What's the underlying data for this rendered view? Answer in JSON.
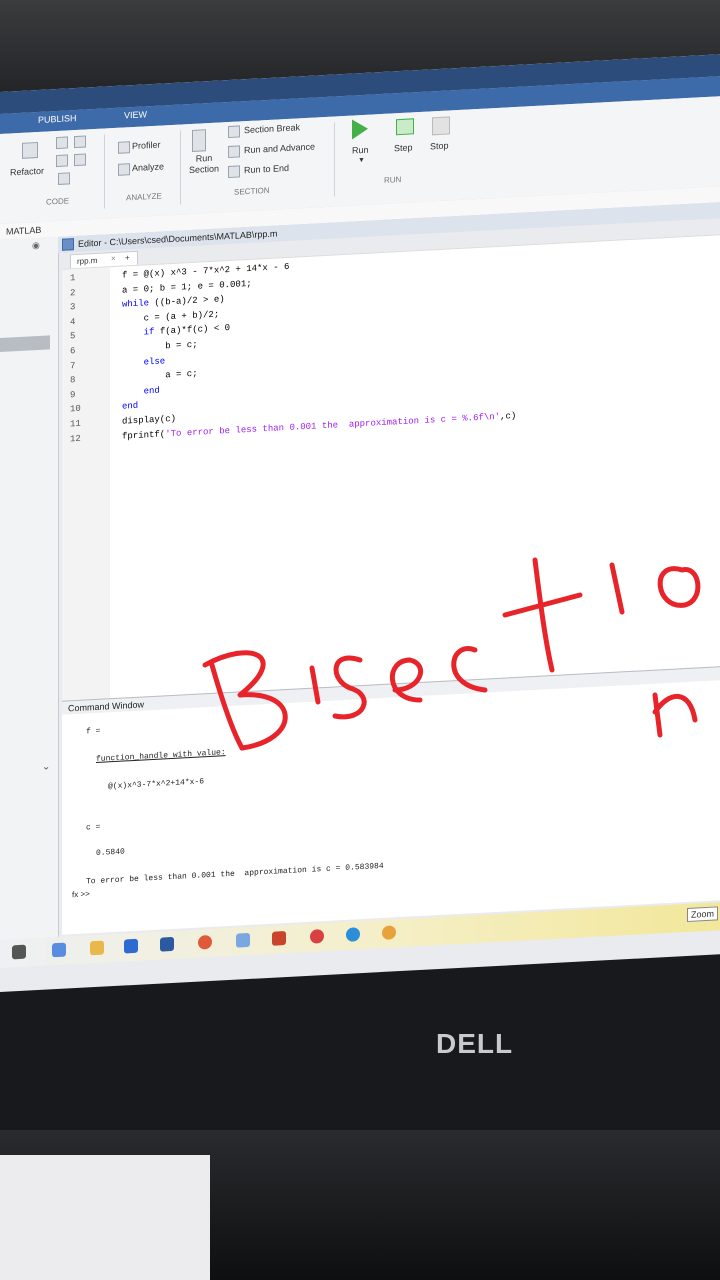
{
  "ribbon": {
    "tabs": [
      "PUBLISH",
      "VIEW"
    ],
    "refactor": "Refactor",
    "code_group": "CODE",
    "profiler": "Profiler",
    "analyze": "Analyze",
    "analyze_group": "ANALYZE",
    "run_section": "Run Section",
    "section_break": "Section Break",
    "run_and_advance": "Run and Advance",
    "run_to_end": "Run to End",
    "section_group": "SECTION",
    "run": "Run",
    "step": "Step",
    "stop": "Stop",
    "run_group": "RUN"
  },
  "left_panel": {
    "title": "MATLAB"
  },
  "editor": {
    "title": "Editor - C:\\Users\\csed\\Documents\\MATLAB\\rpp.m",
    "tab": "rpp.m",
    "tab_close": "×",
    "tab_add": "+",
    "lines": [
      {
        "n": "1",
        "text": "f = @(x) x^3 - 7*x^2 + 14*x - 6"
      },
      {
        "n": "2",
        "text": "a = 0; b = 1; e = 0.001;"
      },
      {
        "n": "3",
        "text": "while ((b-a)/2 > e)"
      },
      {
        "n": "4",
        "text": "    c = (a + b)/2;"
      },
      {
        "n": "5",
        "text": "    if f(a)*f(c) < 0"
      },
      {
        "n": "6",
        "text": "        b = c;"
      },
      {
        "n": "7",
        "text": "    else"
      },
      {
        "n": "8",
        "text": "        a = c;"
      },
      {
        "n": "9",
        "text": "    end"
      },
      {
        "n": "10",
        "text": "end"
      },
      {
        "n": "11",
        "text": "display(c)"
      },
      {
        "n": "12",
        "text": "fprintf('To error be less than 0.001 the  approximation is c = %.6f\\n',c)"
      }
    ]
  },
  "command_window": {
    "title": "Command Window",
    "f_label": "f =",
    "func_handle": "function_handle with value:",
    "func_value": "@(x)x^3-7*x^2+14*x-6",
    "c_label": "c =",
    "c_value": "0.5840",
    "result": "To error be less than 0.001 the  approximation is c = 0.583984",
    "prompt": "fx >>"
  },
  "taskbar": {
    "zoom": "Zoom"
  },
  "brand": "DELL",
  "annotation": {
    "word": "Bisectio n",
    "color": "#e8242b"
  }
}
